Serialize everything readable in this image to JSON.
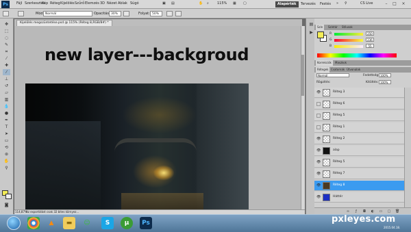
{
  "menu": {
    "logo": "Ps",
    "items": [
      "Fájl",
      "Szerkesztés",
      "Kép",
      "Réteg",
      "Kijelölés",
      "Szűrő",
      "Elemzés",
      "3D",
      "Nézet",
      "Ablak",
      "Súgó"
    ],
    "zoom": "115%",
    "workspaces": [
      "Alapérték",
      "Tervezés",
      "Festés"
    ],
    "cslive": "CS Live"
  },
  "options": {
    "mode_label": "Mód:",
    "mode_value": "Normál",
    "opacity_label": "Opacitás:",
    "opacity_value": "30%",
    "flow_label": "Folyat:",
    "flow_value": "50%"
  },
  "document": {
    "tab_title": "Kijelölés megszüntetése.psd @ 115% (Réteg 8,RGB/8#) *",
    "heading": "new layer---backgroud",
    "zoom_status": "114,87%",
    "status_text": "Az exportálást csak 32 bites környez..."
  },
  "color_panel": {
    "tabs": [
      "Szín",
      "Színtár",
      "Stílusok"
    ],
    "r_label": "R",
    "r_value": "250",
    "g_label": "G",
    "g_value": "236",
    "b_label": "B",
    "b_value": "55",
    "fg_color": "#f3ec57"
  },
  "adjust_panel": {
    "tabs": [
      "Korrekciók",
      "Maszkok"
    ]
  },
  "layers_panel": {
    "tabs": [
      "Rétegek",
      "Csatornák",
      "Útvonalak"
    ],
    "blend_value": "Normál",
    "opacity_label": "Fedettség:",
    "opacity_value": "100%",
    "lock_label": "Rögzítés:",
    "fill_label": "Kitöltés:",
    "fill_value": "100%",
    "layers": [
      {
        "name": "Réteg 3",
        "visible": true,
        "selected": false
      },
      {
        "name": "Réteg 6",
        "visible": false,
        "selected": false
      },
      {
        "name": "Réteg 5",
        "visible": false,
        "selected": false
      },
      {
        "name": "Réteg 1",
        "visible": false,
        "selected": false
      },
      {
        "name": "Réteg 2",
        "visible": true,
        "selected": false
      },
      {
        "name": "alap",
        "visible": true,
        "selected": false
      },
      {
        "name": "Réteg 5",
        "visible": true,
        "selected": false
      },
      {
        "name": "Réteg 7",
        "visible": true,
        "selected": false
      },
      {
        "name": "Réteg 8",
        "visible": true,
        "selected": true
      },
      {
        "name": "Háttér",
        "visible": true,
        "selected": false
      }
    ]
  },
  "taskbar": {
    "apps": [
      "Chrome",
      "VLC",
      "Explorer",
      "Messenger",
      "Skype",
      "uTorrent",
      "Photoshop"
    ],
    "tray_date": "2015.04.18."
  },
  "watermark": "pxleyes.com"
}
